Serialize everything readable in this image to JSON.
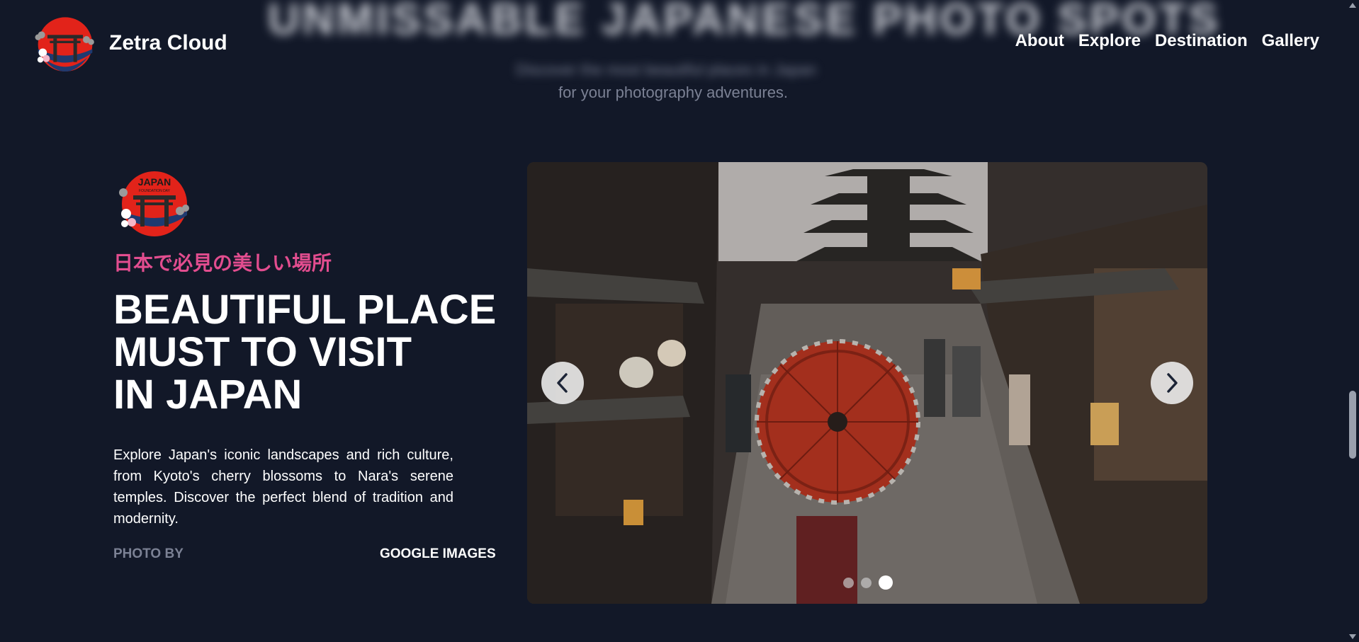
{
  "header": {
    "blurred_headline": "UNMISSABLE JAPANESE PHOTO SPOTS",
    "blurred_subtitle": "Discover the most beautiful places in Japan",
    "subtitle_visible": "for your photography adventures."
  },
  "navbar": {
    "brand_name": "Zetra Cloud",
    "links": [
      {
        "label": "About"
      },
      {
        "label": "Explore"
      },
      {
        "label": "Destination"
      },
      {
        "label": "Gallery"
      }
    ]
  },
  "hero": {
    "logo_text_top": "JAPAN",
    "logo_text_sub": "FOUNDATION DAY",
    "japanese_title": "日本で必見の美しい場所",
    "title_lines": [
      "BEAUTIFUL PLACE",
      "MUST TO VISIT",
      "IN JAPAN"
    ],
    "description": "Explore Japan's iconic landscapes and rich culture, from Kyoto's cherry blossoms to Nara's serene temples. Discover the perfect blend of tradition and modernity.",
    "credit_label": "PHOTO BY",
    "credit_value": "GOOGLE IMAGES"
  },
  "carousel": {
    "image_subject": "Kyoto street with pagoda and red umbrella",
    "slide_count": 3,
    "active_index": 2,
    "prev_icon": "chevron-left-icon",
    "next_icon": "chevron-right-icon"
  },
  "colors": {
    "background": "#121828",
    "accent_pink": "#e24d8f",
    "muted_text": "#7b8194",
    "logo_red": "#e2231a"
  }
}
